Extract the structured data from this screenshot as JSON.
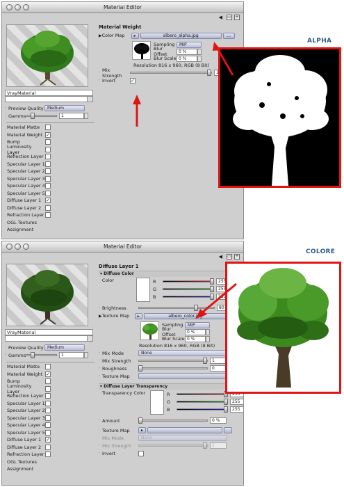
{
  "window1": {
    "title": "Material Editor",
    "material_name": "VrayMaterial",
    "preview_quality": {
      "label": "Preview Quality",
      "value": "Medium"
    },
    "gamma": {
      "label": "Gamma",
      "value": "1"
    },
    "channels": [
      {
        "label": "Material Matte",
        "checked": false
      },
      {
        "label": "Material Weight",
        "checked": true
      },
      {
        "label": "Bump",
        "checked": false
      },
      {
        "label": "Luminosity Layer",
        "checked": false
      },
      {
        "label": "Reflection Layer",
        "checked": false
      },
      {
        "label": "Specular Layer 1",
        "checked": false
      },
      {
        "label": "Specular Layer 2",
        "checked": false
      },
      {
        "label": "Specular Layer 3",
        "checked": false
      },
      {
        "label": "Specular Layer 4",
        "checked": false
      },
      {
        "label": "Specular Layer 5",
        "checked": false
      },
      {
        "label": "Diffuse Layer 1",
        "checked": true
      },
      {
        "label": "Diffuse Layer 2",
        "checked": false
      },
      {
        "label": "Refraction Layer",
        "checked": false
      },
      {
        "label": "OGL Textures",
        "checked": null
      },
      {
        "label": "Assignment",
        "checked": null
      }
    ],
    "section_title": "Material Weight",
    "color_map_label": "Color Map",
    "color_map_file": "albero_alpha.jpg",
    "more_button": "...",
    "sampling_label": "Sampling",
    "sampling_value": "MIP",
    "blur_offset_label": "Blur Offset",
    "blur_offset_value": "0 %",
    "blur_scale_label": "Blur Scale",
    "blur_scale_value": "0 %",
    "resolution": "Resolution 816 x 960, RGB (8 Bit)",
    "mix_strength_label": "Mix Strength",
    "mix_strength_value": "1",
    "invert_label": "Invert",
    "invert_checked": true
  },
  "window2": {
    "title": "Material Editor",
    "material_name": "VrayMaterial",
    "preview_quality": {
      "label": "Preview Quality",
      "value": "Medium"
    },
    "gamma": {
      "label": "Gamma",
      "value": "1"
    },
    "channels": [
      {
        "label": "Material Matte",
        "checked": false
      },
      {
        "label": "Material Weight",
        "checked": true
      },
      {
        "label": "Bump",
        "checked": false
      },
      {
        "label": "Luminosity Layer",
        "checked": false
      },
      {
        "label": "Reflection Layer",
        "checked": false
      },
      {
        "label": "Specular Layer 1",
        "checked": false
      },
      {
        "label": "Specular Layer 2",
        "checked": false
      },
      {
        "label": "Specular Layer 3",
        "checked": false
      },
      {
        "label": "Specular Layer 4",
        "checked": false
      },
      {
        "label": "Specular Layer 5",
        "checked": false
      },
      {
        "label": "Diffuse Layer 1",
        "checked": true
      },
      {
        "label": "Diffuse Layer 2",
        "checked": false
      },
      {
        "label": "Refraction Layer",
        "checked": false
      },
      {
        "label": "OGL Textures",
        "checked": null
      },
      {
        "label": "Assignment",
        "checked": null
      }
    ],
    "section_title": "Diffuse Layer 1",
    "diffuse_color_head": "Diffuse Color",
    "color_label": "Color",
    "rgb": [
      {
        "ch": "R",
        "value": "255"
      },
      {
        "ch": "G",
        "value": "255"
      },
      {
        "ch": "B",
        "value": "255"
      }
    ],
    "brightness_label": "Brightness",
    "brightness_value": "80 %",
    "texture_map_label": "Texture Map",
    "texture_file": "albero_color.jpg",
    "sampling_label": "Sampling",
    "sampling_value": "MIP",
    "blur_offset_label": "Blur Offset",
    "blur_offset_value": "0 %",
    "blur_scale_label": "Blur Scale",
    "blur_scale_value": "0 %",
    "resolution": "Resolution 816 x 960, RGB (8 Bit)",
    "mix_mode_label": "Mix Mode",
    "mix_mode_value": "None",
    "mix_strength_label": "Mix Strength",
    "mix_strength_value": "1",
    "roughness_label": "Roughness",
    "roughness_value": "0",
    "texture_map2_label": "Texture Map",
    "transp_head": "Diffuse Layer Transparency",
    "transp_color_label": "Transparency Color",
    "transp_rgb": [
      {
        "ch": "R",
        "value": "255"
      },
      {
        "ch": "G",
        "value": "255"
      },
      {
        "ch": "B",
        "value": "255"
      }
    ],
    "amount_label": "Amount",
    "amount_value": "0 %",
    "texture_map3_label": "Texture Map",
    "mix_mode2_label": "Mix Mode",
    "mix_mode2_value": "None",
    "mix_strength2_label": "Mix Strength",
    "mix_strength2_value": "1",
    "invert_label": "Invert"
  },
  "callouts": {
    "alpha": "ALPHA",
    "colore": "COLORE"
  },
  "colors": {
    "red": "#e01414",
    "label_blue": "#2a5c8a",
    "tree_green": "#3c8a1e",
    "trunk": "#4a3a28"
  }
}
